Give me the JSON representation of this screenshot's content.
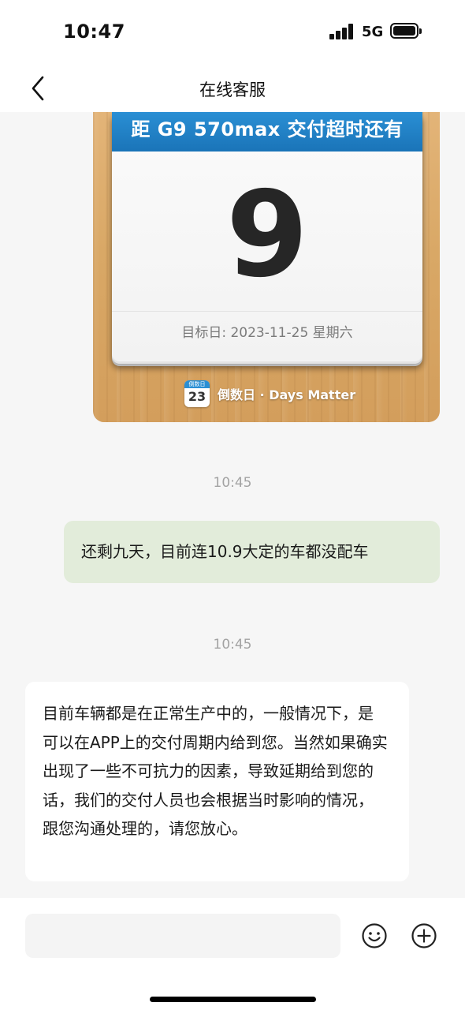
{
  "status_bar": {
    "time": "10:47",
    "network": "5G"
  },
  "nav": {
    "title": "在线客服",
    "back_icon": "chevron-left-icon"
  },
  "countdown_card": {
    "header": "距 G9 570max 交付超时还有",
    "days": "9",
    "target_date": "目标日: 2023-11-25 星期六",
    "brand_icon_label": "倒数日",
    "brand_icon_number": "23",
    "brand_name": "倒数日 · Days Matter",
    "header_color": "#1f80c6"
  },
  "messages": [
    {
      "timestamp": "10:45",
      "sender": "user",
      "text": "还剩九天，目前连10.9大定的车都没配车"
    },
    {
      "timestamp": "10:45",
      "sender": "agent",
      "text": "目前车辆都是在正常生产中的，一般情况下，是可以在APP上的交付周期内给到您。当然如果确实出现了一些不可抗力的因素，导致延期给到您的话，我们的交付人员也会根据当时影响的情况，跟您沟通处理的，请您放心。"
    }
  ],
  "input_bar": {
    "placeholder": "",
    "emoji_icon": "smiley-icon",
    "plus_icon": "plus-circle-icon"
  },
  "colors": {
    "user_bubble": "#e2ecda",
    "agent_bubble": "#ffffff",
    "background": "#f6f6f6"
  }
}
